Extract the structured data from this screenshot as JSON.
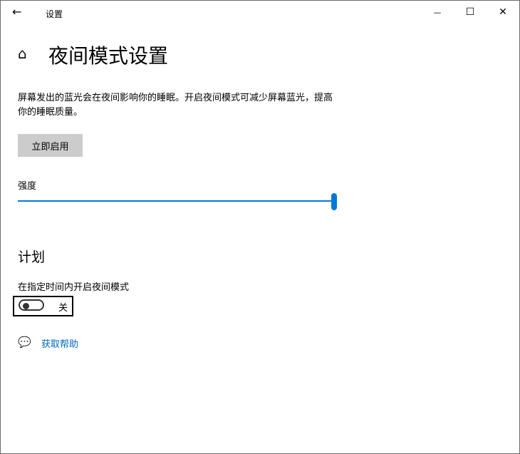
{
  "window": {
    "title": "设置",
    "back": "←",
    "minimize": "—",
    "maximize": "☐",
    "close": "✕"
  },
  "page": {
    "title": "夜间模式设置",
    "description": "屏幕发出的蓝光会在夜间影响你的睡眠。开启夜间模式可减少屏幕蓝光，提高你的睡眠质量。",
    "enable_now": "立即启用",
    "strength_label": "强度",
    "strength_value": 100
  },
  "schedule": {
    "heading": "计划",
    "toggle_label": "在指定时间内开启夜间模式",
    "toggle_state": "关"
  },
  "help": {
    "link": "获取帮助"
  },
  "colors": {
    "accent": "#0078d7"
  }
}
